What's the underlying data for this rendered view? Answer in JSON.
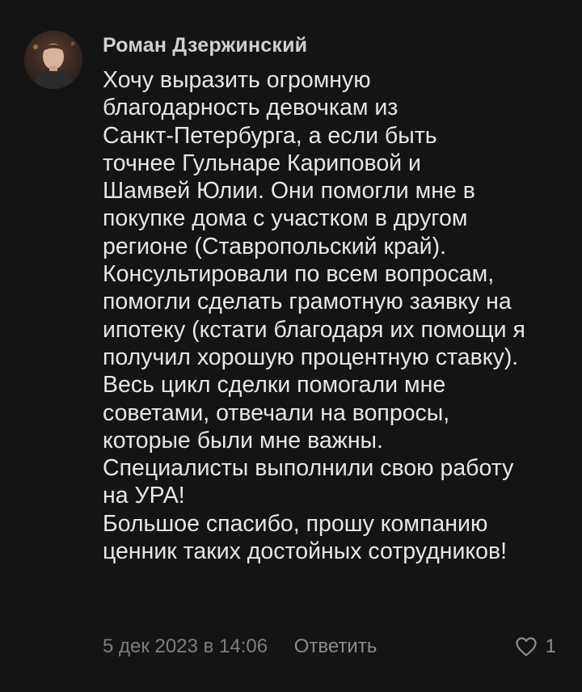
{
  "comment": {
    "author": "Роман Дзержинский",
    "avatar_icon": "user-avatar-photo",
    "text_lines": [
      "Хочу выразить огромную",
      "благодарность девочкам из",
      "Санкт-Петербурга, а если быть",
      "точнее Гульнаре Кариповой и",
      "Шамвей Юлии. Они помогли мне в",
      "покупке дома с участком в другом",
      "регионе (Ставропольский край).",
      "Консультировали по всем вопросам,",
      "помогли сделать грамотную заявку на",
      "ипотеку (кстати благодаря их помощи я",
      "получил хорошую процентную ставку).",
      "Весь цикл сделки помогали мне",
      "советами, отвечали на вопросы,",
      "которые были мне важны.",
      "Специалисты выполнили свою работу",
      "на УРА!",
      "Большое спасибо, прошу компанию",
      "ценник таких достойных сотрудников!"
    ],
    "date": "5 дек 2023 в 14:06",
    "reply_label": "Ответить",
    "like_icon": "heart-outline-icon",
    "like_count": "1"
  },
  "colors": {
    "background": "#141414",
    "author": "#cfcfd1",
    "text": "#e6e6e8",
    "meta": "#7d7d82"
  }
}
